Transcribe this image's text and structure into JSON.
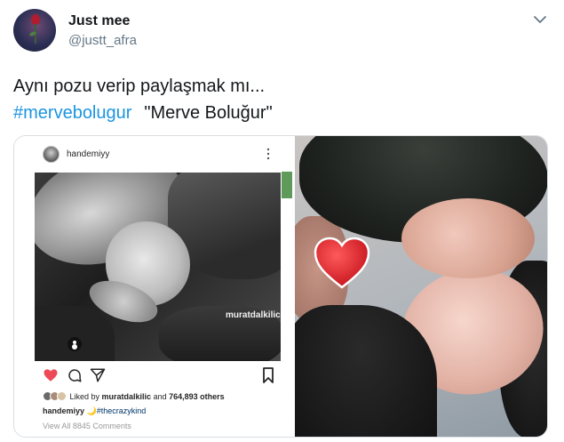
{
  "tweet": {
    "author": {
      "display_name": "Just mee",
      "handle": "@justt_afra"
    },
    "text_line1": "Aynı pozu verip paylaşmak mı...",
    "hashtag": "#mervebolugur",
    "quoted_name": "\"Merve Boluğur\""
  },
  "media": {
    "instagram_post": {
      "username": "handemiyy",
      "photo_watermark": "muratdalkilic",
      "likes_prefix": "Liked by ",
      "likes_user": "muratdalkilic",
      "likes_middle": " and ",
      "likes_count": "764,893 others",
      "caption_user": "handemiyy",
      "caption_emoji": "🌙",
      "caption_tag": "#thecrazykind",
      "view_all": "View All 8845 Comments"
    }
  },
  "colors": {
    "link": "#1b95e0",
    "secondary_text": "#657786",
    "heart_red": "#ed4956",
    "sticker_heart": "#e8282b"
  },
  "icons": {
    "menu": "chevron-down-icon",
    "like": "heart-icon",
    "comment": "comment-icon",
    "share": "paper-plane-icon",
    "save": "bookmark-icon",
    "tag": "person-tag-icon"
  }
}
